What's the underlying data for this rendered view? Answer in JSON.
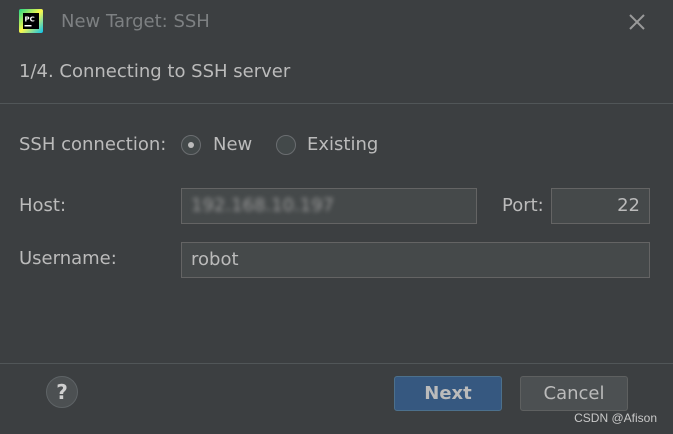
{
  "window": {
    "title": "New Target: SSH",
    "app_icon": "pycharm-logo",
    "close_icon": "close-icon"
  },
  "step": {
    "title": "1/4. Connecting to SSH server"
  },
  "form": {
    "connection_label": "SSH connection:",
    "connection_options": [
      {
        "label": "New",
        "selected": true
      },
      {
        "label": "Existing",
        "selected": false
      }
    ],
    "host_label": "Host:",
    "host_value": "192.168.10.197",
    "port_label": "Port:",
    "port_value": "22",
    "username_label": "Username:",
    "username_value": "robot"
  },
  "footer": {
    "help_label": "?",
    "next_label": "Next",
    "cancel_label": "Cancel",
    "watermark": "CSDN @Afison"
  },
  "colors": {
    "background": "#3c3f41",
    "primary_button": "#365880",
    "field_background": "#45494a",
    "text": "#bbbbbb"
  }
}
